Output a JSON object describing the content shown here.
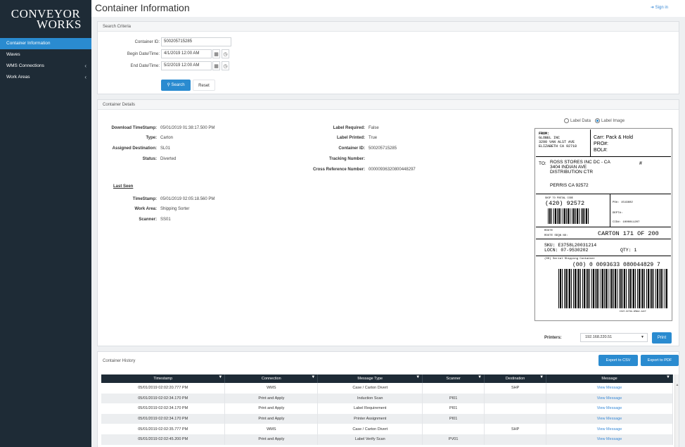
{
  "app": {
    "logo_line1": "CONVEYOR",
    "logo_line2": "WORKS",
    "title": "Container Information",
    "signin": "Sign in"
  },
  "sidebar": {
    "items": [
      {
        "label": "Container Information",
        "active": true
      },
      {
        "label": "Waves"
      },
      {
        "label": "WMS Connections",
        "chevron": "‹"
      },
      {
        "label": "Work Areas",
        "chevron": "‹"
      }
    ]
  },
  "search": {
    "header": "Search Criteria",
    "container_id_label": "Container ID:",
    "container_id_value": "500205715285",
    "begin_label": "Begin Date/Time:",
    "begin_value": "4/1/2019 12:00 AM",
    "end_label": "End Date/Time:",
    "end_value": "5/2/2019 12:00 AM",
    "search_btn": "Search",
    "reset_btn": "Reset"
  },
  "details": {
    "header": "Container Details",
    "left": [
      {
        "k": "Download TimeStamp:",
        "v": "05/01/2019 01:38:17.500 PM"
      },
      {
        "k": "Type:",
        "v": "Carton"
      },
      {
        "k": "Assigned Destination:",
        "v": "SL01"
      },
      {
        "k": "Status:",
        "v": "Diverted"
      }
    ],
    "right": [
      {
        "k": "Label Required:",
        "v": "False"
      },
      {
        "k": "Label Printed:",
        "v": "True"
      },
      {
        "k": "Container ID:",
        "v": "500205715285"
      },
      {
        "k": "Tracking Number:",
        "v": ""
      },
      {
        "k": "Cross Reference Number:",
        "v": "00000936320800448297"
      }
    ],
    "last_seen_title": "Last Seen",
    "last_seen": [
      {
        "k": "TimeStamp:",
        "v": "05/01/2019 02:05:18.560 PM"
      },
      {
        "k": "Work Area:",
        "v": "Shipping Sorter"
      },
      {
        "k": "Scanner:",
        "v": "SS01"
      }
    ],
    "radio_data": "Label Data",
    "radio_image": "Label Image",
    "printers_label": "Printers:",
    "printer_value": "192.168.220.51",
    "print_btn": "Print"
  },
  "label": {
    "from": "FROM:",
    "from_lines": [
      "GLOBEL INC",
      "3290 VAN ALST AVE",
      "ELIZABETH CA 92718"
    ],
    "carr": "Carr: Pack & Hold",
    "pro": "PRO#:",
    "bol": "BOL#:",
    "to": "TO:",
    "to_lines": [
      "ROSS STORES INC DC - CA",
      "3404 INDIAN AVE",
      "DISTRIBUTION CTR"
    ],
    "hash": "#",
    "city": "PERRIS CA 92572",
    "postal_caption": "SHIP TO POSTAL CODE",
    "postal": "(420) 92572",
    "po": "PO#: 1519602",
    "dept": "DEPT#:",
    "cid": "CID#: 1000011207",
    "route": "ROUTE",
    "route2": "ROUTE SEQN NO:",
    "carton": "CARTON 171 OF 200",
    "sku": "SKU: E3758L20031214",
    "locn": "LOCN: 07-9530202",
    "qty": "QTY: 1",
    "sscc_title": "(00) Serial Shipping Container",
    "sscc": "(00) 0 0093633 080044829 7",
    "tiny": "FX0T-6CT3H-9M0EC-4ACT"
  },
  "history": {
    "title": "Container History",
    "export_csv": "Export to CSV",
    "export_pdf": "Export to PDF",
    "columns": [
      "Timestamp",
      "Connection",
      "Message Type",
      "Scanner",
      "Destination",
      "Message"
    ],
    "rows": [
      [
        "05/01/2019 02:02:20.777 PM",
        "WMS",
        "Case / Carton Divert",
        "",
        "SHP",
        "View Message"
      ],
      [
        "05/01/2019 02:02:34.170 PM",
        "Print and Apply",
        "Induction Scan",
        "PI01",
        "",
        "View Message"
      ],
      [
        "05/01/2019 02:02:34.170 PM",
        "Print and Apply",
        "Label Requirement",
        "PI01",
        "",
        "View Message"
      ],
      [
        "05/01/2019 02:02:34.170 PM",
        "Print and Apply",
        "Printer Assignment",
        "PI01",
        "",
        "View Message"
      ],
      [
        "05/01/2019 02:02:35.777 PM",
        "WMS",
        "Case / Carton Divert",
        "",
        "SHP",
        "View Message"
      ],
      [
        "05/01/2019 02:02:45.200 PM",
        "Print and Apply",
        "Label Verify Scan",
        "PV01",
        "",
        "View Message"
      ]
    ]
  },
  "colors": {
    "accent": "#2a8bd0",
    "sidebar": "#1e2b36",
    "link": "#3a8ad6"
  }
}
